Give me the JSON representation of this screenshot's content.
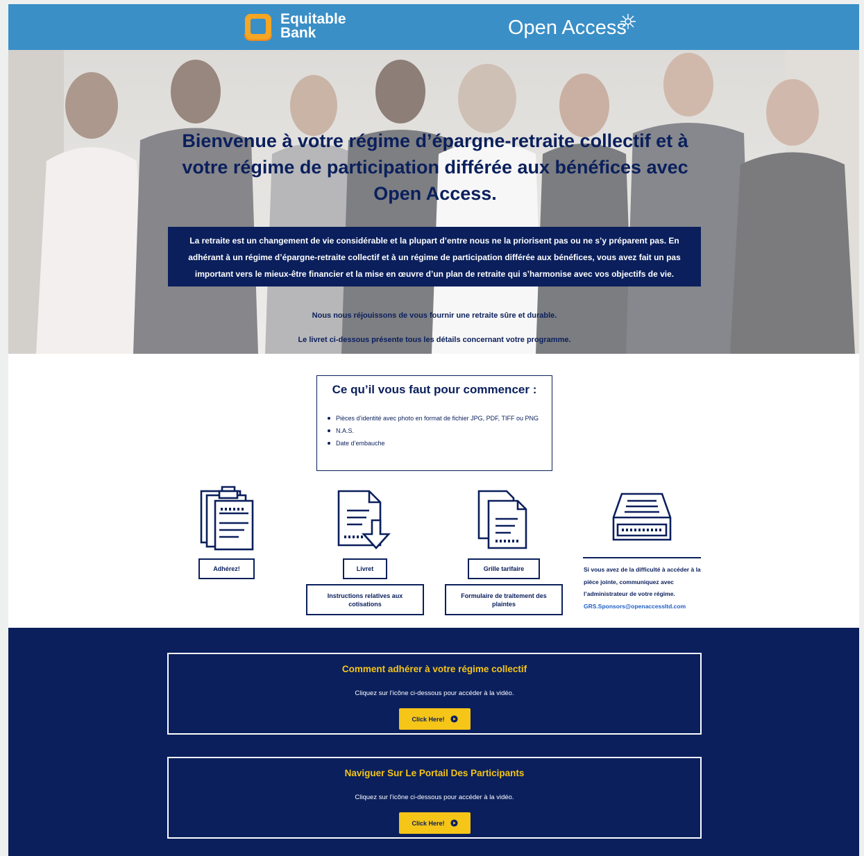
{
  "header": {
    "bank_logo_line1": "Equitable",
    "bank_logo_line2": "Bank",
    "partner_logo": "Open Access"
  },
  "hero": {
    "title": "Bienvenue à votre régime d’épargne-retraite collectif et à votre régime de participation différée aux bénéfices avec Open Access.",
    "intro": "La retraite est un changement de vie considérable et la plupart d’entre nous ne la priorisent pas ou ne s’y préparent pas. En adhérant à un régime d’épargne-retraite collectif et à un régime de participation différée aux bénéfices, vous avez fait un pas important vers le mieux-être financier et la mise en œuvre d’un plan de retraite qui s’harmonise avec vos objectifs de vie.",
    "line1": "Nous nous réjouissons de vous fournir une retraite sûre et durable.",
    "line2": "Le livret ci-dessous présente tous les détails concernant votre programme."
  },
  "requirements": {
    "title": "Ce qu’il vous faut pour commencer :",
    "items": [
      "Pièces d’identité avec photo en format de fichier JPG, PDF, TIFF ou PNG",
      "N.A.S.",
      "Date d’embauche"
    ]
  },
  "actions": {
    "join": "Adhérez!",
    "booklet": "Livret",
    "rates": "Grille tarifaire",
    "contributions": "Instructions relatives aux cotisations",
    "complaints": "Formulaire de traitement des plaintes",
    "help_text": "Si vous avez de la difficulté à accéder à la pièce jointe, communiquez avec l’administrateur de votre régime.",
    "help_email": "GRS.Sponsors@openaccessltd.com"
  },
  "videos": [
    {
      "title": "Comment adhérer à votre régime collectif",
      "subtitle": "Cliquez sur l’icône ci-dessous pour accéder à la vidéo.",
      "button": "Click Here!"
    },
    {
      "title": "Naviguer Sur Le Portail Des Participants",
      "subtitle": "Cliquez sur l’icône ci-dessous pour accéder à la vidéo.",
      "button": "Click Here!"
    }
  ],
  "colors": {
    "header_blue": "#3a8fc7",
    "navy": "#0a1f5c",
    "accent_yellow": "#f5c518",
    "link_blue": "#1f5fc4"
  },
  "icons": [
    "equitable-bank-logo",
    "flower-icon",
    "clipboard-icon",
    "document-download-icon",
    "documents-icon",
    "inbox-tray-icon",
    "play-icon"
  ]
}
